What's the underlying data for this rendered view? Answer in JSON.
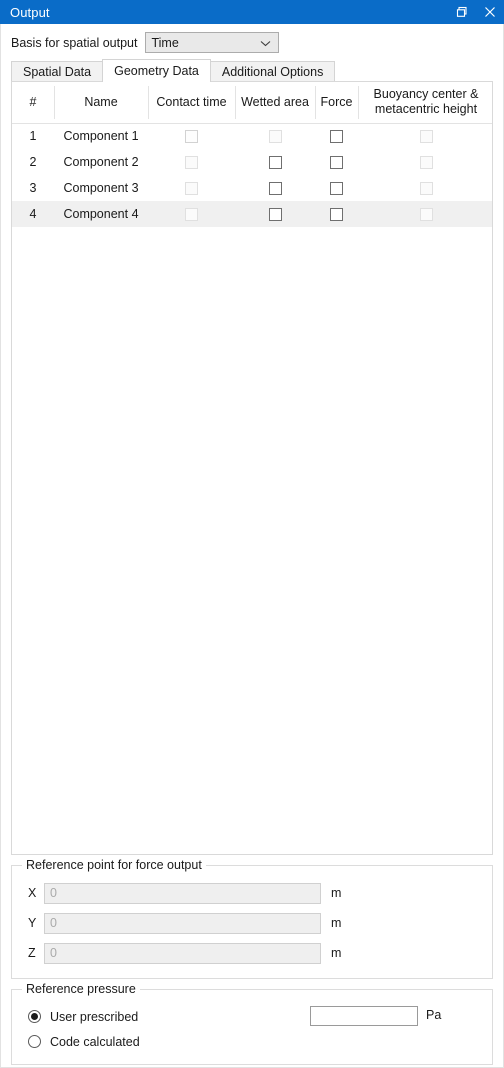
{
  "window": {
    "title": "Output",
    "restore_icon": "restore-window-icon",
    "close_icon": "close-icon"
  },
  "basis": {
    "label": "Basis for spatial output",
    "value": "Time",
    "chevron_icon": "chevron-down-icon"
  },
  "tabs": [
    {
      "label": "Spatial Data",
      "active": false
    },
    {
      "label": "Geometry Data",
      "active": true
    },
    {
      "label": "Additional Options",
      "active": false
    }
  ],
  "table": {
    "columns": [
      {
        "label": "#"
      },
      {
        "label": "Name"
      },
      {
        "label": "Contact time"
      },
      {
        "label": "Wetted area"
      },
      {
        "label": "Force"
      },
      {
        "label": "Buoyancy center &",
        "label2": "metacentric height"
      }
    ],
    "rows": [
      {
        "num": "1",
        "name": "Component 1",
        "selected": false,
        "contact_time": {
          "checked": false,
          "state": "dim"
        },
        "wetted_area": {
          "checked": false,
          "state": "disabled"
        },
        "force": {
          "checked": false,
          "state": "enabled"
        },
        "buoyancy": {
          "checked": false,
          "state": "disabled"
        }
      },
      {
        "num": "2",
        "name": "Component 2",
        "selected": false,
        "contact_time": {
          "checked": false,
          "state": "disabled"
        },
        "wetted_area": {
          "checked": false,
          "state": "enabled"
        },
        "force": {
          "checked": false,
          "state": "enabled"
        },
        "buoyancy": {
          "checked": false,
          "state": "disabled"
        }
      },
      {
        "num": "3",
        "name": "Component 3",
        "selected": false,
        "contact_time": {
          "checked": false,
          "state": "disabled"
        },
        "wetted_area": {
          "checked": false,
          "state": "enabled"
        },
        "force": {
          "checked": false,
          "state": "enabled"
        },
        "buoyancy": {
          "checked": false,
          "state": "disabled"
        }
      },
      {
        "num": "4",
        "name": "Component 4",
        "selected": true,
        "contact_time": {
          "checked": false,
          "state": "disabled"
        },
        "wetted_area": {
          "checked": false,
          "state": "enabled"
        },
        "force": {
          "checked": false,
          "state": "enabled"
        },
        "buoyancy": {
          "checked": false,
          "state": "disabled"
        }
      }
    ]
  },
  "reference_point": {
    "title": "Reference point for force output",
    "fields": [
      {
        "label": "X",
        "value": "0",
        "unit": "m"
      },
      {
        "label": "Y",
        "value": "0",
        "unit": "m"
      },
      {
        "label": "Z",
        "value": "0",
        "unit": "m"
      }
    ]
  },
  "reference_pressure": {
    "title": "Reference pressure",
    "options": [
      {
        "label": "User prescribed",
        "selected": true
      },
      {
        "label": "Code calculated",
        "selected": false
      }
    ],
    "pressure_value": "",
    "pressure_unit": "Pa"
  },
  "colors": {
    "titlebar": "#0a6cc8",
    "titlebar_text": "#ffffff",
    "panel_bg": "#ffffff",
    "row_selected": "#f0f0f0",
    "disabled_field_bg": "#efefef"
  }
}
